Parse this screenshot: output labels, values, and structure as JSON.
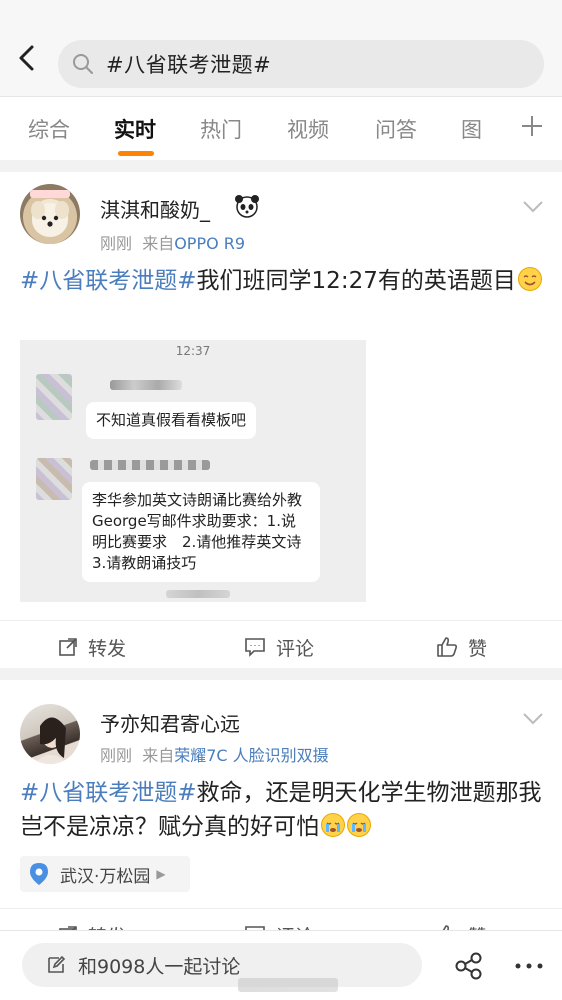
{
  "search": {
    "query": "#八省联考泄题#"
  },
  "tabs": [
    {
      "label": "综合"
    },
    {
      "label": "实时",
      "active": true
    },
    {
      "label": "热门"
    },
    {
      "label": "视频"
    },
    {
      "label": "问答"
    },
    {
      "label": "图"
    }
  ],
  "posts": [
    {
      "username": "淇淇和酸奶_",
      "time": "刚刚",
      "source_prefix": "来自",
      "source": "OPPO R9",
      "hashtag": "#八省联考泄题#",
      "text": "我们班同学12:27有的英语题目",
      "image": {
        "time": "12:37",
        "bubble1": "不知道真假看看模板吧",
        "bubble2": "李华参加英文诗朗诵比赛给外教George写邮件求助要求：1.说明比赛要求　2.请他推荐英文诗　3.请教朗诵技巧"
      },
      "actions": {
        "repost": "转发",
        "comment": "评论",
        "like": "赞"
      }
    },
    {
      "username": "予亦知君寄心远",
      "time": "刚刚",
      "source_prefix": "来自",
      "source": "荣耀7C 人脸识别双摄",
      "hashtag": "#八省联考泄题#",
      "text": "救命，还是明天化学生物泄题那我岂不是凉凉？赋分真的好可怕",
      "location": "武汉·万松园",
      "actions": {
        "repost": "转发",
        "comment": "评论",
        "like": "赞"
      }
    }
  ],
  "bottom": {
    "discuss": "和9098人一起讨论"
  },
  "colors": {
    "accent": "#ff8200",
    "link": "#4a7dbd"
  },
  "icons": [
    "back-arrow-icon",
    "search-icon",
    "plus-icon",
    "chevron-down-icon",
    "repost-icon",
    "comment-icon",
    "like-icon",
    "location-icon",
    "edit-icon",
    "share-icon",
    "more-icon"
  ]
}
